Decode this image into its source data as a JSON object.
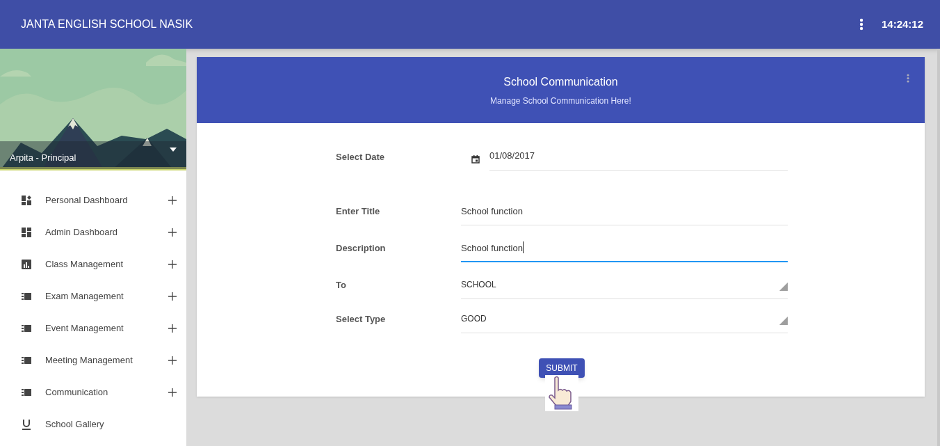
{
  "app_bar": {
    "title": "JANTA ENGLISH SCHOOL NASIK",
    "clock": "14:24:12"
  },
  "sidebar": {
    "user": "Arpita - Principal",
    "items": [
      {
        "label": "Personal Dashboard",
        "expandable": true
      },
      {
        "label": "Admin Dashboard",
        "expandable": true
      },
      {
        "label": "Class Management",
        "expandable": true
      },
      {
        "label": "Exam Management",
        "expandable": true
      },
      {
        "label": "Event Management",
        "expandable": true
      },
      {
        "label": "Meeting Management",
        "expandable": true
      },
      {
        "label": "Communication",
        "expandable": true
      },
      {
        "label": "School Gallery",
        "expandable": false
      }
    ]
  },
  "card": {
    "title": "School Communication",
    "subtitle": "Manage School Communication Here!",
    "fields": [
      {
        "kind": "date",
        "label": "Select Date",
        "value": "01/08/2017",
        "focused": false
      },
      {
        "kind": "text",
        "label": "Enter Title",
        "value": "School function",
        "focused": false
      },
      {
        "kind": "text",
        "label": "Description",
        "value": "School function",
        "focused": true
      },
      {
        "kind": "select",
        "label": "To",
        "value": "SCHOOL",
        "focused": false
      },
      {
        "kind": "select",
        "label": "Select Type",
        "value": "GOOD",
        "focused": false
      }
    ],
    "submit": "SUBMIT"
  }
}
